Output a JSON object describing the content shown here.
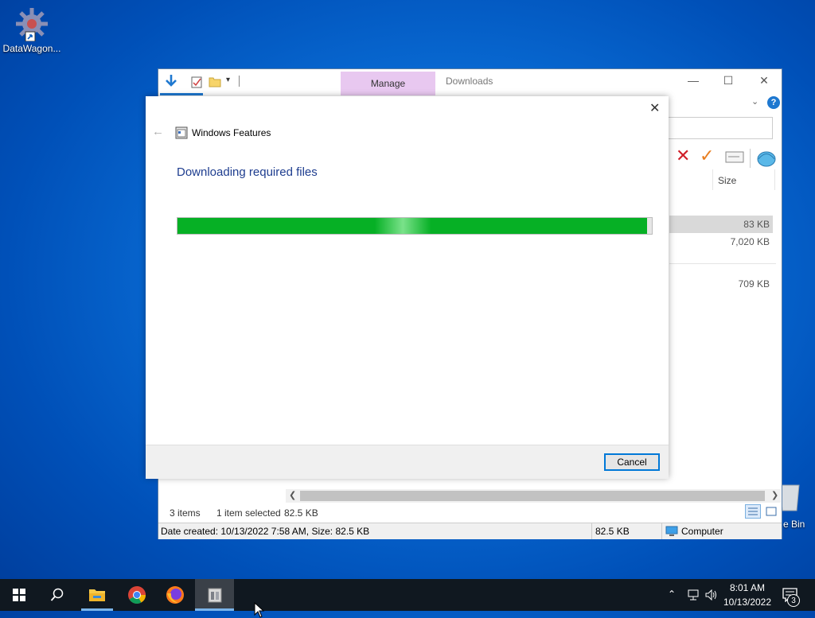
{
  "desktop": {
    "icons": [
      {
        "label": "DataWagon..."
      },
      {
        "label": "Recycle Bin",
        "visible_label": "e Bin"
      }
    ]
  },
  "explorer": {
    "ribbon": {
      "manage_tab": "Manage",
      "title": "Downloads"
    },
    "columns": {
      "size": "Size"
    },
    "rows": [
      {
        "size": "83 KB"
      },
      {
        "size": "7,020 KB"
      },
      {
        "size": "709 KB"
      }
    ],
    "status": {
      "items_count": "3 items",
      "selected": "1 item selected",
      "selected_size": "82.5 KB"
    },
    "details_bar": {
      "info": "Date created: 10/13/2022 7:58 AM, Size: 82.5 KB",
      "size": "82.5 KB",
      "location": "Computer"
    }
  },
  "dialog": {
    "title": "Windows Features",
    "heading": "Downloading required files",
    "progress": 0.99,
    "cancel_label": "Cancel"
  },
  "taskbar": {
    "time": "8:01 AM",
    "date": "10/13/2022",
    "notification_count": "3"
  },
  "colors": {
    "accent": "#0078d7",
    "progress": "#06b025",
    "heading": "#1e3d8f",
    "taskbar": "#101820"
  }
}
